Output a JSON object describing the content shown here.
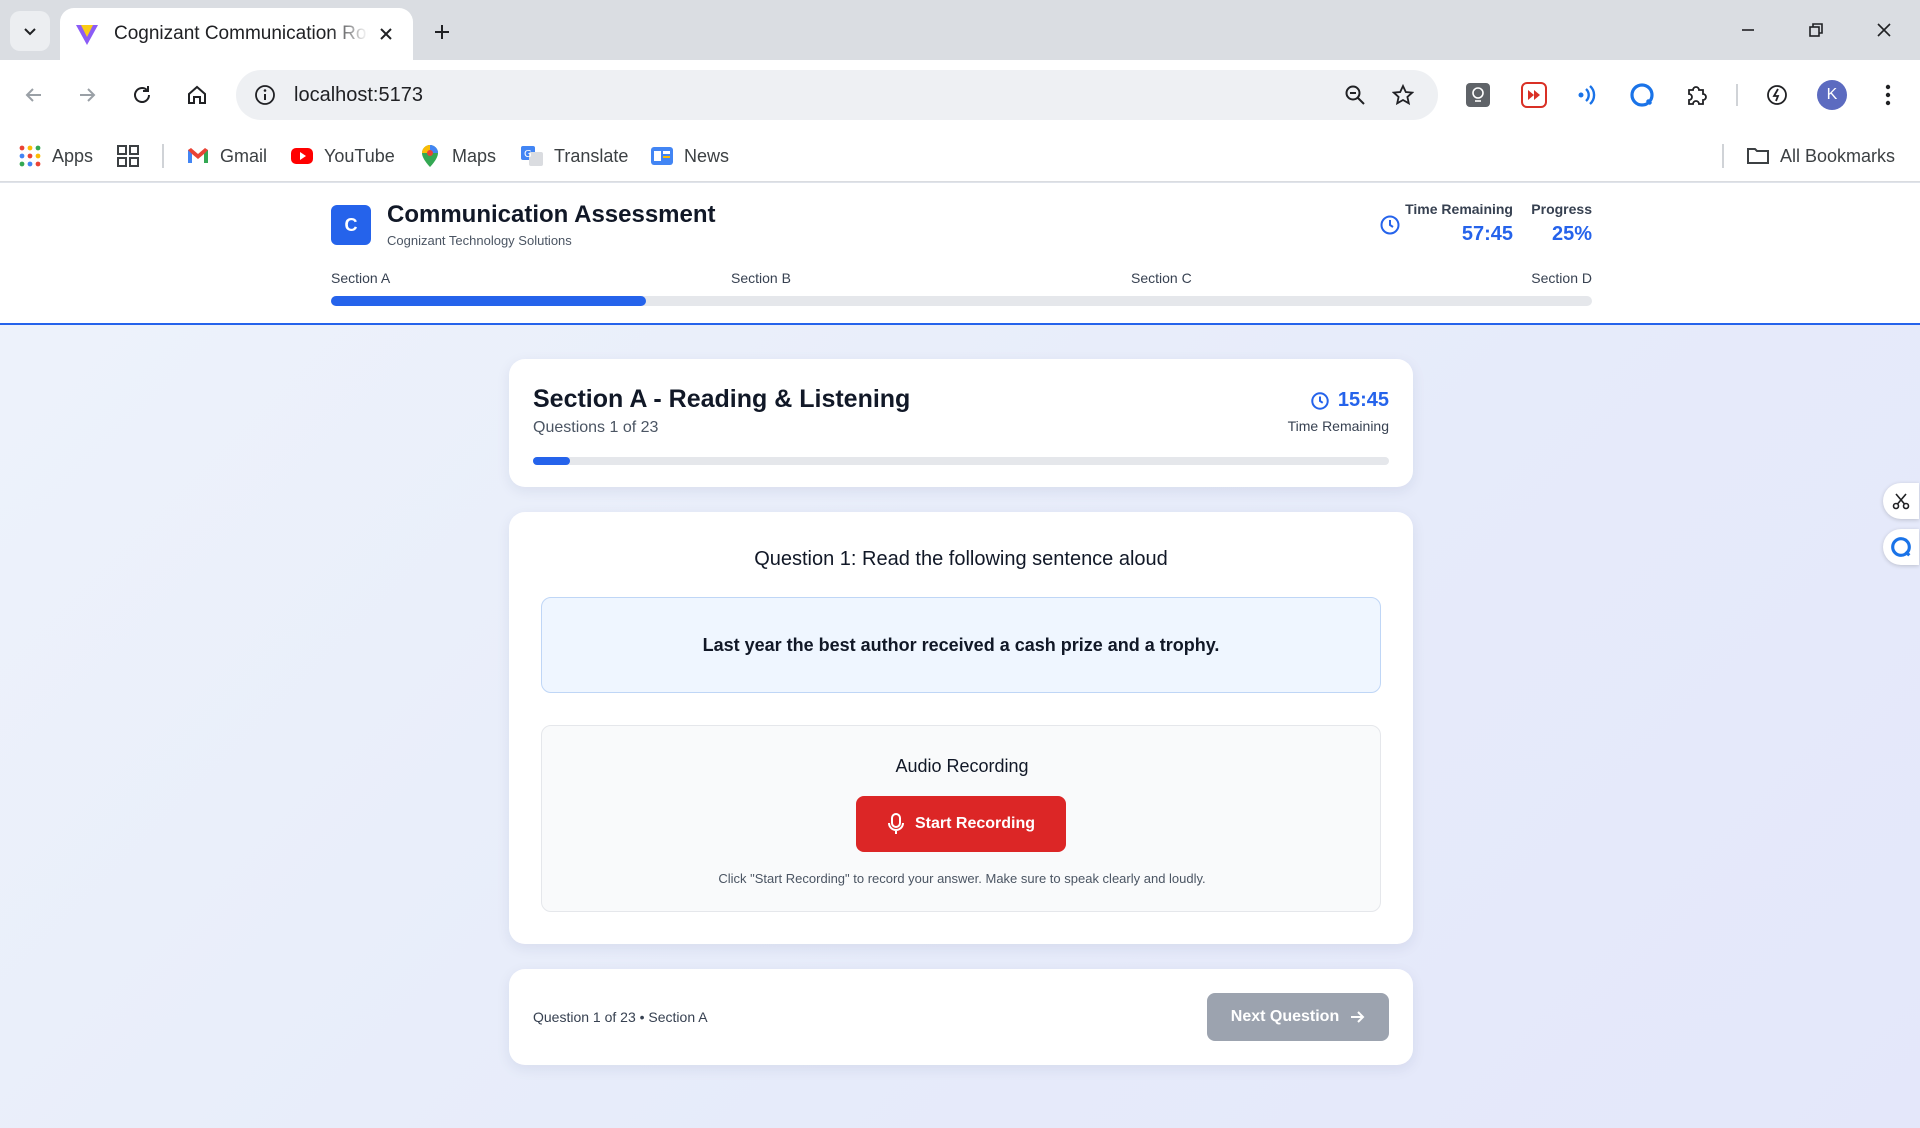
{
  "browser": {
    "tab_title": "Cognizant Communication Round",
    "url": "localhost:5173",
    "avatar_letter": "K",
    "bookmarks": [
      {
        "label": "Apps",
        "icon": "apps-grid-icon"
      },
      {
        "label": "Gmail",
        "icon": "gmail-icon"
      },
      {
        "label": "YouTube",
        "icon": "youtube-icon"
      },
      {
        "label": "Maps",
        "icon": "maps-icon"
      },
      {
        "label": "Translate",
        "icon": "translate-icon"
      },
      {
        "label": "News",
        "icon": "news-icon"
      }
    ],
    "all_bookmarks": "All Bookmarks"
  },
  "header": {
    "logo_letter": "C",
    "title": "Communication Assessment",
    "subtitle": "Cognizant Technology Solutions",
    "time_label": "Time Remaining",
    "time_value": "57:45",
    "progress_label": "Progress",
    "progress_value": "25%",
    "progress_fraction": 0.25,
    "sections": [
      "Section A",
      "Section B",
      "Section C",
      "Section D"
    ]
  },
  "section_card": {
    "title": "Section A - Reading & Listening",
    "count": "Questions 1 of 23",
    "timer": "15:45",
    "timer_label": "Time Remaining",
    "progress_fraction": 0.043
  },
  "question": {
    "title": "Question 1: Read the following sentence aloud",
    "sentence": "Last year the best author received a cash prize and a trophy.",
    "recording_title": "Audio Recording",
    "record_button": "Start Recording",
    "hint": "Click \"Start Recording\" to record your answer. Make sure to speak clearly and loudly."
  },
  "footer": {
    "info": "Question 1 of 23 • Section A",
    "next_button": "Next Question"
  },
  "colors": {
    "accent": "#2563eb",
    "record": "#dc2626",
    "disabled": "#9ca3af"
  }
}
